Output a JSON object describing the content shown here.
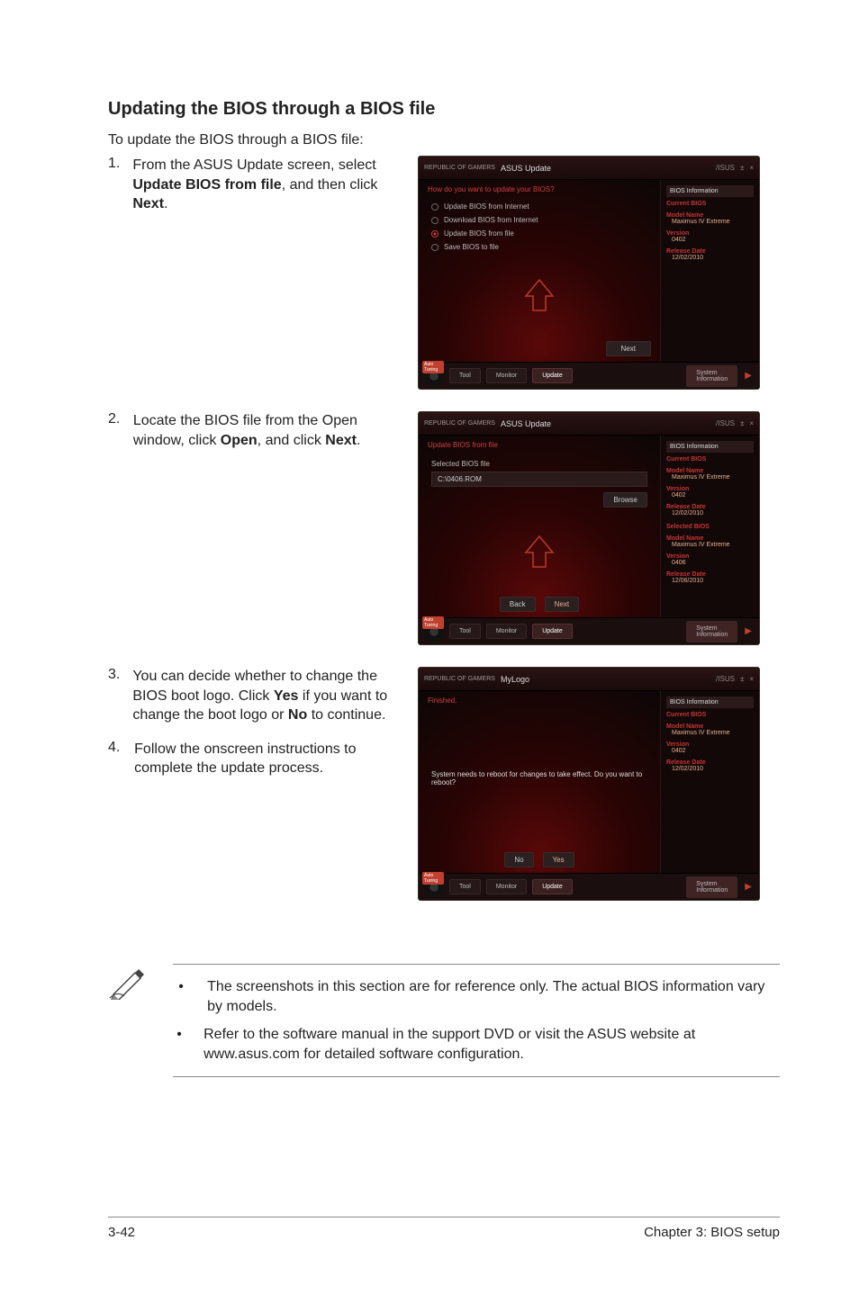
{
  "heading": "Updating the BIOS through a BIOS file",
  "intro": "To update the BIOS through a BIOS file:",
  "steps": {
    "s1": {
      "num": "1.",
      "text_a": "From the ASUS Update screen, select ",
      "bold_a": "Update BIOS from file",
      "text_b": ", and then click ",
      "bold_b": "Next",
      "text_c": "."
    },
    "s2": {
      "num": "2.",
      "text_a": "Locate the BIOS file from the Open window, click ",
      "bold_a": "Open",
      "text_b": ", and click ",
      "bold_b": "Next",
      "text_c": "."
    },
    "s3": {
      "num": "3.",
      "text_a": "You can decide whether to change the BIOS boot logo. Click ",
      "bold_a": "Yes",
      "text_b": " if you want to change the boot logo or ",
      "bold_b": "No",
      "text_c": " to continue."
    },
    "s4": {
      "num": "4.",
      "text_a": "Follow the onscreen instructions to complete the update process."
    }
  },
  "app": {
    "rog": "REPUBLIC OF\nGAMERS",
    "asus_brand": "/ISUS",
    "pin": "±",
    "close": "×",
    "title_update": "ASUS Update",
    "title_mylogo": "MyLogo",
    "bottom": {
      "tool": "Tool",
      "monitor": "Monitor",
      "update": "Update",
      "system": "System\nInformation",
      "auto": "Auto\nTuning"
    }
  },
  "shot1": {
    "question": "How do you want to update your BIOS?",
    "opts": [
      "Update BIOS from Internet",
      "Download BIOS from Internet",
      "Update BIOS from file",
      "Save BIOS to file"
    ],
    "next": "Next",
    "info": {
      "head": "BIOS Information",
      "current": "Current BIOS",
      "model_l": "Model Name",
      "model_v": "Maximus IV Extreme",
      "ver_l": "Version",
      "ver_v": "0402",
      "date_l": "Release Date",
      "date_v": "12/02/2010"
    }
  },
  "shot2": {
    "head": "Update BIOS from file",
    "sel_label": "Selected BIOS file",
    "path": "C:\\0406.ROM",
    "browse": "Browse",
    "back": "Back",
    "next": "Next",
    "info": {
      "head": "BIOS Information",
      "current": "Current BIOS",
      "model_l": "Model Name",
      "model_v": "Maximus IV Extreme",
      "ver_l": "Version",
      "ver_v": "0402",
      "date_l": "Release Date",
      "date_v": "12/02/2010",
      "selected": "Selected BIOS",
      "smodel_l": "Model Name",
      "smodel_v": "Maximus IV Extreme",
      "sver_l": "Version",
      "sver_v": "0406",
      "sdate_l": "Release Date",
      "sdate_v": "12/06/2010"
    }
  },
  "shot3": {
    "head": "Finished.",
    "msg": "System needs to reboot for changes to take effect. Do you want to reboot?",
    "no": "No",
    "yes": "Yes",
    "info": {
      "head": "BIOS Information",
      "current": "Current BIOS",
      "model_l": "Model Name",
      "model_v": "Maximus IV Extreme",
      "ver_l": "Version",
      "ver_v": "0402",
      "date_l": "Release Date",
      "date_v": "12/02/2010"
    }
  },
  "notes": {
    "n1": "The screenshots in this section are for reference only. The actual BIOS information vary by models.",
    "n2": "Refer to the software manual in the support DVD or visit the ASUS website at www.asus.com for detailed software configuration."
  },
  "footer": {
    "left": "3-42",
    "right": "Chapter 3: BIOS setup"
  }
}
